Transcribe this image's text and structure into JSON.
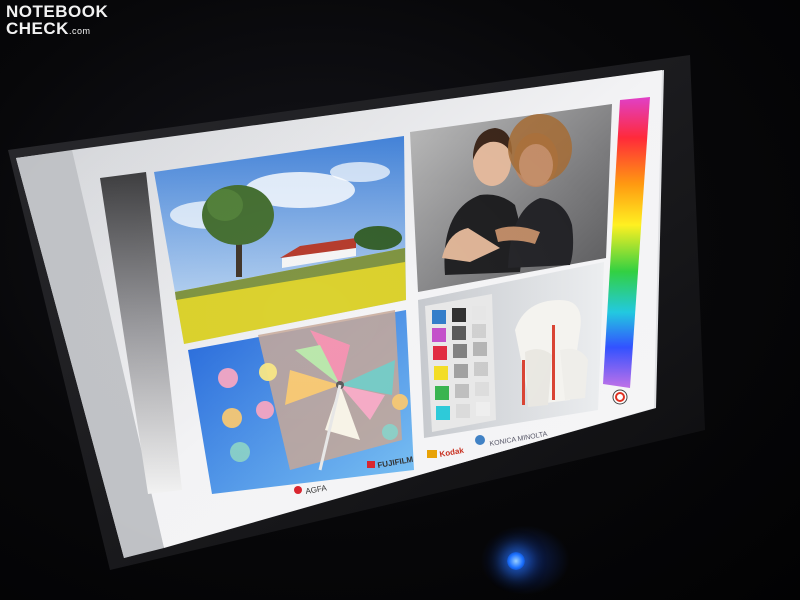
{
  "watermark": {
    "line1": "NOTEBOOK",
    "line2": "CHECK",
    "suffix": ".com"
  },
  "test_chart": {
    "brands": [
      {
        "name": "AGFA",
        "color": "#d8202a"
      },
      {
        "name": "FUJIFILM",
        "color": "#d8202a"
      },
      {
        "name": "Kodak",
        "color": "#e8a000"
      },
      {
        "name": "KONICA MINOLTA",
        "color": "#3d7fc4"
      }
    ]
  },
  "colors": {
    "power_led": "#1a6fff",
    "screen_white": "#e9e9ec"
  }
}
